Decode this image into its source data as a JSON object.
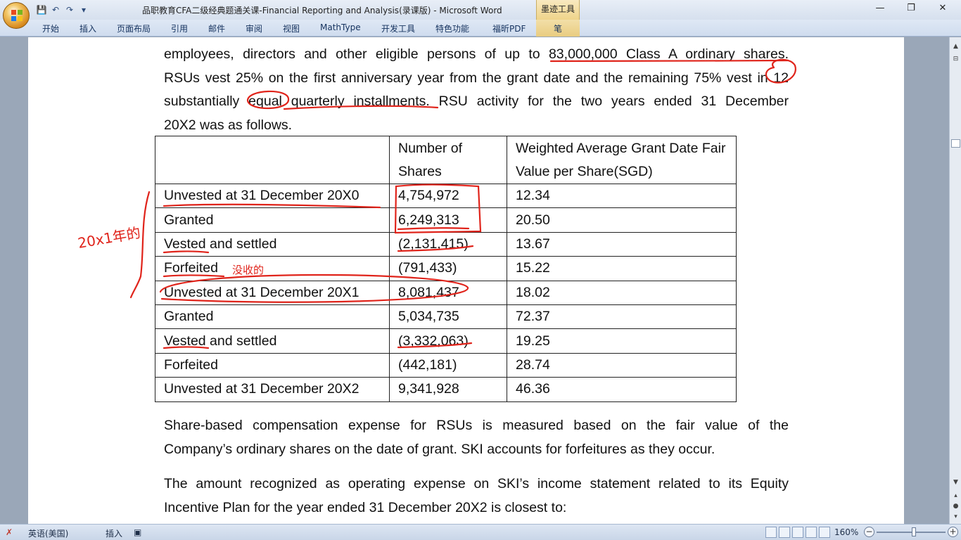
{
  "window": {
    "title": "品职教育CFA二级经典题通关课-Financial Reporting and Analysis(录课版) - Microsoft Word",
    "context_tab": "墨迹工具",
    "minimize": "—",
    "restore": "❐",
    "close": "✕"
  },
  "quick_access": {
    "save": "💾",
    "undo": "↶",
    "redo": "↷",
    "more": "▾"
  },
  "ribbon": {
    "tabs": [
      "开始",
      "插入",
      "页面布局",
      "引用",
      "邮件",
      "审阅",
      "视图",
      "MathType",
      "开发工具",
      "特色功能",
      "福昕PDF",
      "笔"
    ]
  },
  "document": {
    "para1_lines": [
      "employees, directors and other eligible persons of up to 83,000,000 Class A ordinary shares.",
      "RSUs vest 25% on the first anniversary year from the grant date and the remaining 75% vest in 12",
      "substantially equal quarterly installments. RSU activity for the two years ended 31 December"
    ],
    "para1_last": "20X2 was as follows.",
    "table": {
      "headers": [
        "",
        "Number of Shares",
        "Weighted Average Grant Date Fair Value per Share(SGD)"
      ],
      "rows": [
        [
          "Unvested at 31 December 20X0",
          "4,754,972",
          "12.34"
        ],
        [
          "Granted",
          "6,249,313",
          "20.50"
        ],
        [
          "Vested and settled",
          "(2,131,415)",
          "13.67"
        ],
        [
          "Forfeited",
          "(791,433)",
          "15.22"
        ],
        [
          "Unvested at 31 December 20X1",
          "8,081,437",
          "18.02"
        ],
        [
          "Granted",
          "5,034,735",
          "72.37"
        ],
        [
          "Vested and settled",
          "(3,332,063)",
          "19.25"
        ],
        [
          "Forfeited",
          "(442,181)",
          "28.74"
        ],
        [
          "Unvested at 31 December 20X2",
          "9,341,928",
          "46.36"
        ]
      ]
    },
    "para2_line1": "Share-based compensation expense for RSUs is measured based on the fair value of the",
    "para2_line2": "Company’s ordinary shares on the date of grant. SKI accounts for forfeitures as they occur.",
    "para3_line1": "The amount recognized as operating expense on SKI’s income statement related to its Equity",
    "para3_line2": "Incentive Plan for the year ended 31 December 20X2 is closest to:"
  },
  "annotations": {
    "handwritten_left": "20x1年的",
    "handwritten_forfeit": "没收的"
  },
  "statusbar": {
    "language": "英语(美国)",
    "insert_mode": "插入",
    "zoom": "160%"
  },
  "colors": {
    "ink": "#e0241b",
    "ribbon": "#d6e0ee",
    "workspace": "#9aa7b8"
  }
}
